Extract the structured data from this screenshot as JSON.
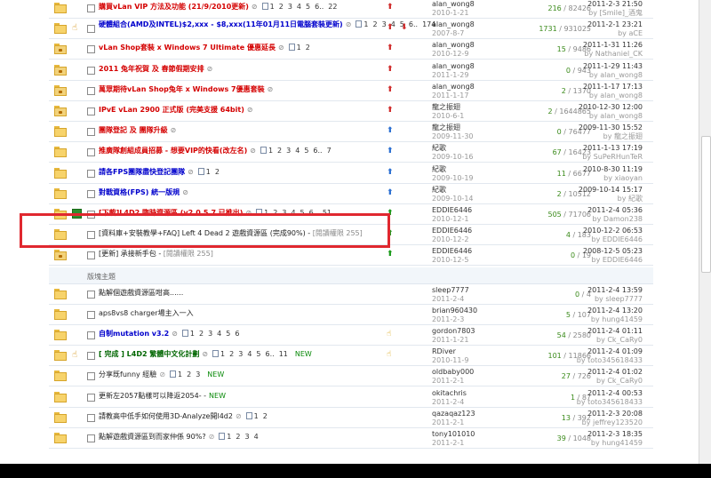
{
  "threads": [
    {
      "title": "購買vLan VIP 方法及功能 (21/9/2010更新)",
      "style": "red",
      "pages": [
        "1",
        "2",
        "3",
        "4",
        "5",
        "6..",
        "22"
      ],
      "author": "alan_wong8",
      "date": "2010-1-21",
      "replies": "216",
      "views": "82426",
      "last_time": "2011-2-3 21:50",
      "last_by": "by [Smile]_酒鬼"
    },
    {
      "title": "硬體組合(AMD及INTEL)$2,xxx - $8,xxx(11年01月11日電腦套裝更新)",
      "style": "blue",
      "pages": [
        "1",
        "2",
        "3",
        "4",
        "5",
        "6..",
        "174"
      ],
      "author": "alan_wong8",
      "date": "2007-8-7",
      "replies": "1731",
      "views": "931025",
      "last_time": "2011-2-1 23:21",
      "last_by": "by aCE"
    },
    {
      "title": "vLan Shop套裝 x Windows 7 Ultimate 優惠延長",
      "style": "red",
      "pages": [
        "1",
        "2"
      ],
      "author": "alan_wong8",
      "date": "2010-12-9",
      "replies": "15",
      "views": "9486",
      "last_time": "2011-1-31 11:26",
      "last_by": "by Nathaniel_CK"
    },
    {
      "title": "2011 兔年祝賀 及 春節假期安排",
      "style": "red",
      "pages": [],
      "author": "alan_wong8",
      "date": "2011-1-29",
      "replies": "0",
      "views": "943",
      "last_time": "2011-1-29 11:43",
      "last_by": "by alan_wong8"
    },
    {
      "title": "萬眾期待vLan Shop兔年 x Windows 7優惠套裝",
      "style": "red",
      "pages": [],
      "author": "alan_wong8",
      "date": "2011-1-17",
      "replies": "2",
      "views": "1370",
      "last_time": "2011-1-17 17:13",
      "last_by": "by alan_wong8"
    },
    {
      "title": "IPvE vLan 2900 正式版 (完美支援 64bit)",
      "style": "red",
      "pages": [],
      "author": "龍之振翅",
      "date": "2010-6-1",
      "replies": "2",
      "views": "1644865",
      "last_time": "2010-12-30 12:00",
      "last_by": "by alan_wong8"
    },
    {
      "title": "團隊登記 及 團隊升級",
      "style": "red",
      "pages": [],
      "author": "龍之振翅",
      "date": "2009-11-30",
      "replies": "0",
      "views": "76477",
      "last_time": "2009-11-30 15:52",
      "last_by": "by 龍之振翅"
    },
    {
      "title": "推廣隊創組成員招募 - 想要VIP的快看(改左名)",
      "style": "red",
      "pages": [
        "1",
        "2",
        "3",
        "4",
        "5",
        "6..",
        "7"
      ],
      "author": "紀歌",
      "date": "2009-10-16",
      "replies": "67",
      "views": "16423",
      "last_time": "2011-1-13 17:19",
      "last_by": "by SuPeRHunTeR"
    },
    {
      "title": "請各FPS團隊盡快登記團隊",
      "style": "blue",
      "pages": [
        "1",
        "2"
      ],
      "author": "紀歌",
      "date": "2009-10-19",
      "replies": "11",
      "views": "6677",
      "last_time": "2010-8-30 11:19",
      "last_by": "by xiaoyan"
    },
    {
      "title": "對戰資格(FPS) 統一版規",
      "style": "blue",
      "pages": [],
      "author": "紀歌",
      "date": "2009-10-14",
      "replies": "2",
      "views": "10512",
      "last_time": "2009-10-14 15:17",
      "last_by": "by 紀歌"
    },
    {
      "title": "[下載]L4D2 臨時資源區 (v2.0.5.7 已推出)",
      "style": "red",
      "pages": [
        "1",
        "2",
        "3",
        "4",
        "5",
        "6..",
        "51"
      ],
      "author": "EDDIE6446",
      "date": "2010-12-1",
      "replies": "505",
      "views": "71706",
      "last_time": "2011-2-4 05:36",
      "last_by": "by Damon238"
    },
    {
      "title": "[資料庫+安裝教學+FAQ] Left 4 Dead 2 遊戲資源區 (完成90%) -",
      "aux": "[閱讀權限 255]",
      "style": "normal",
      "pages": [],
      "author": "EDDIE6446",
      "date": "2010-12-2",
      "replies": "4",
      "views": "183",
      "last_time": "2010-12-2 06:53",
      "last_by": "by EDDIE6446"
    },
    {
      "title": "[更新] 承接新手包 -",
      "aux": "[閱讀權限 255]",
      "style": "normal",
      "pages": [],
      "author": "EDDIE6446",
      "date": "2010-12-5",
      "replies": "0",
      "views": "19",
      "last_time": "2008-12-5 05:23",
      "last_by": "by EDDIE6446"
    }
  ],
  "separator_label": "版塊主題",
  "normal_threads": [
    {
      "title": "點解個遊戲資源區咁高......",
      "style": "normal",
      "pages": [],
      "author": "sleep7777",
      "date": "2011-2-4",
      "replies": "0",
      "views": "4",
      "last_time": "2011-2-4 13:59",
      "last_by": "by sleep7777"
    },
    {
      "title": "aps8vs8 charger場主入一入",
      "style": "normal",
      "pages": [],
      "author": "brian960430",
      "date": "2011-2-3",
      "replies": "5",
      "views": "107",
      "last_time": "2011-2-4 13:20",
      "last_by": "by hung41459"
    },
    {
      "title": "自制mutation v3.2",
      "style": "blue",
      "pages": [
        "1",
        "2",
        "3",
        "4",
        "5",
        "6"
      ],
      "author": "gordon7803",
      "date": "2011-1-21",
      "replies": "54",
      "views": "2580",
      "last_time": "2011-2-4 01:11",
      "last_by": "by Ck_CaRy0"
    },
    {
      "title": "[ 完成 ] L4D2 繁體中文化計劃",
      "style": "green",
      "pages": [
        "1",
        "2",
        "3",
        "4",
        "5",
        "6..",
        "11"
      ],
      "new": "NEW",
      "author": "RDiver",
      "date": "2010-11-9",
      "replies": "101",
      "views": "11866",
      "last_time": "2011-2-4 01:09",
      "last_by": "by toto345618433"
    },
    {
      "title": "分享既funny 經驗",
      "style": "normal",
      "pages": [
        "1",
        "2",
        "3"
      ],
      "new": "NEW",
      "author": "oldbaby000",
      "date": "2011-2-1",
      "replies": "27",
      "views": "726",
      "last_time": "2011-2-4 01:02",
      "last_by": "by Ck_CaRy0"
    },
    {
      "title": "更新左2057點樣可以降返2054- -",
      "style": "normal",
      "pages": [],
      "new": "NEW",
      "author": "okitachris",
      "date": "2011-2-4",
      "replies": "1",
      "views": "87",
      "last_time": "2011-2-4 00:53",
      "last_by": "by toto345618433"
    },
    {
      "title": "請教高中低手如何使用3D-Analyze開l4d2",
      "style": "normal",
      "pages": [
        "1",
        "2"
      ],
      "author": "qazaqaz123",
      "date": "2011-2-1",
      "replies": "13",
      "views": "392",
      "last_time": "2011-2-3 20:08",
      "last_by": "by jeffrey123520"
    },
    {
      "title": "點解遊戲資源區到而家仲係 90%?",
      "style": "normal",
      "pages": [
        "1",
        "2",
        "3",
        "4"
      ],
      "author": "tony101010",
      "date": "2011-2-1",
      "replies": "39",
      "views": "1048",
      "last_time": "2011-2-3 18:35",
      "last_by": "by hung41459"
    }
  ],
  "colors": {
    "highlight": "#e0282f",
    "title_red": "#d40000",
    "title_blue": "#0000cc",
    "replies_green": "#3a8a1a"
  }
}
